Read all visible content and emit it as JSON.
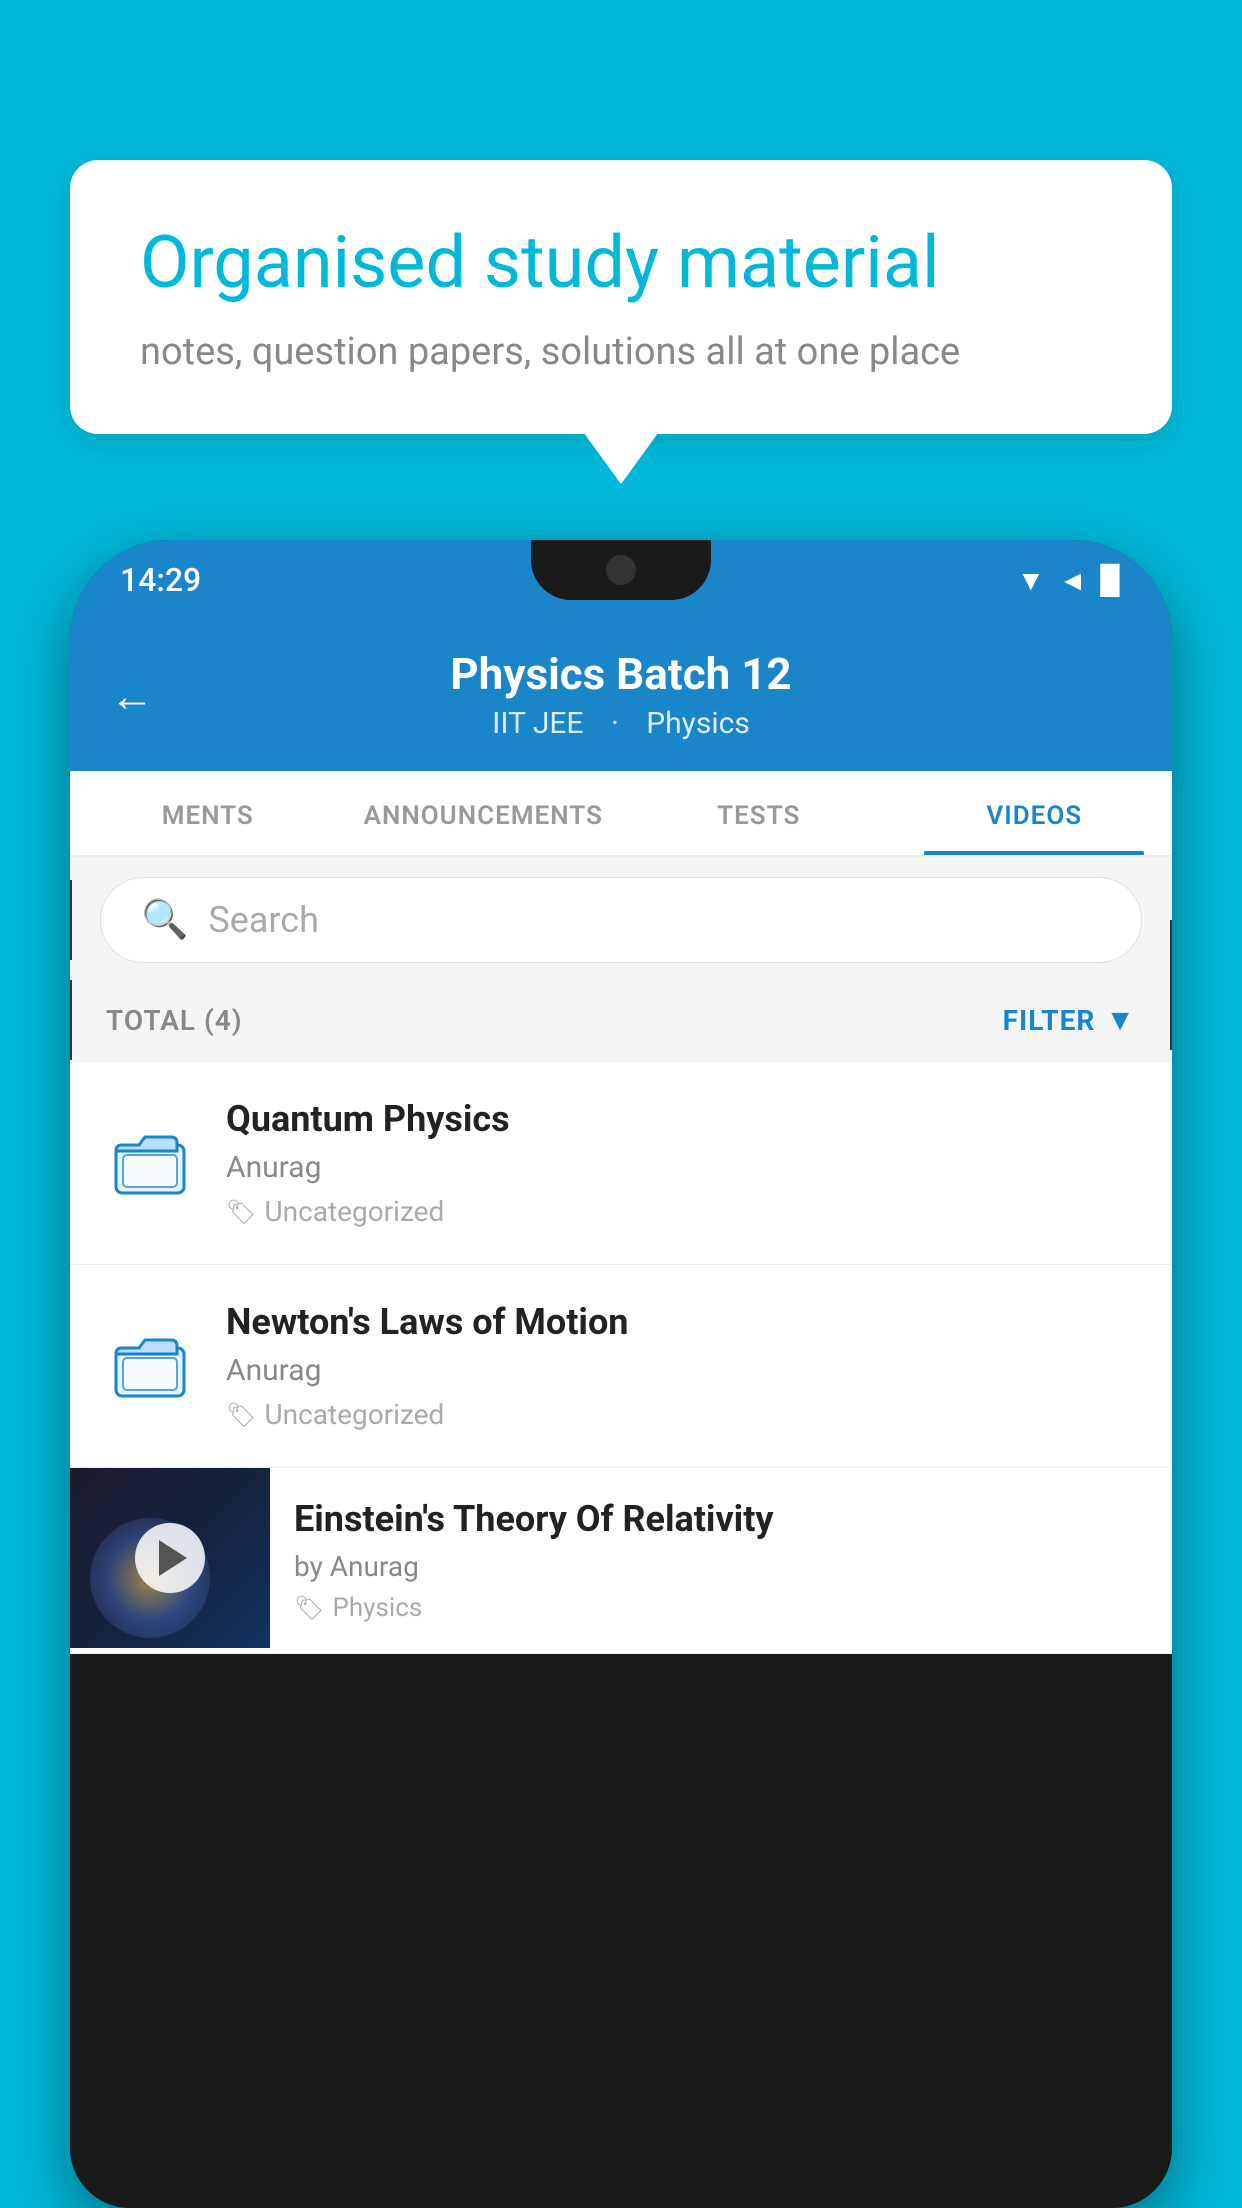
{
  "bubble": {
    "title": "Organised study material",
    "subtitle": "notes, question papers, solutions all at one place"
  },
  "status_bar": {
    "time": "14:29"
  },
  "header": {
    "title": "Physics Batch 12",
    "subtitle_tag1": "IIT JEE",
    "subtitle_tag2": "Physics"
  },
  "tabs": [
    {
      "label": "MENTS",
      "active": false
    },
    {
      "label": "ANNOUNCEMENTS",
      "active": false
    },
    {
      "label": "TESTS",
      "active": false
    },
    {
      "label": "VIDEOS",
      "active": true
    }
  ],
  "search": {
    "placeholder": "Search"
  },
  "total_filter": {
    "total_label": "TOTAL (4)",
    "filter_label": "FILTER"
  },
  "videos": [
    {
      "title": "Quantum Physics",
      "author": "Anurag",
      "tag": "Uncategorized",
      "has_thumb": false
    },
    {
      "title": "Newton's Laws of Motion",
      "author": "Anurag",
      "tag": "Uncategorized",
      "has_thumb": false
    },
    {
      "title": "Einstein's Theory Of Relativity",
      "author": "by Anurag",
      "tag": "Physics",
      "has_thumb": true
    }
  ]
}
